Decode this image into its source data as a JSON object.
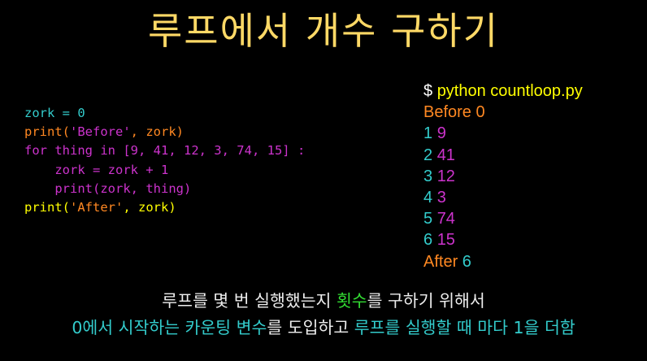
{
  "title": {
    "text": "루프에서 개수 구하기",
    "color": "#FFD966"
  },
  "colors": {
    "cyan": "#33CCCC",
    "pink": "#CC33CC",
    "orange": "#FF8822",
    "white": "#FFFFFF",
    "yellow": "#FFFF00",
    "green": "#33DD33",
    "light": "#EEEEEE"
  },
  "code_lines": [
    [
      {
        "t": "zork = 0",
        "c": "cyan"
      }
    ],
    [
      {
        "t": "print(",
        "c": "orange"
      },
      {
        "t": "'Before'",
        "c": "pink"
      },
      {
        "t": ", zork)",
        "c": "orange"
      }
    ],
    [
      {
        "t": "for ",
        "c": "pink"
      },
      {
        "t": "thing ",
        "c": "pink"
      },
      {
        "t": "in ",
        "c": "pink"
      },
      {
        "t": "[9, 41, 12, 3, 74, 15] :",
        "c": "pink"
      }
    ],
    [
      {
        "t": "    zork = zork + 1",
        "c": "pink"
      }
    ],
    [
      {
        "t": "    print(",
        "c": "pink"
      },
      {
        "t": "zork, thing",
        "c": "pink"
      },
      {
        "t": ")",
        "c": "pink"
      }
    ],
    [
      {
        "t": "print(",
        "c": "yellow"
      },
      {
        "t": "'After'",
        "c": "orange"
      },
      {
        "t": ", zork)",
        "c": "yellow"
      }
    ]
  ],
  "output_lines": [
    [
      {
        "t": "$ ",
        "c": "white"
      },
      {
        "t": "python countloop.py",
        "c": "yellow"
      }
    ],
    [
      {
        "t": "Before 0",
        "c": "orange"
      }
    ],
    [
      {
        "t": "1 ",
        "c": "cyan"
      },
      {
        "t": "9",
        "c": "pink"
      }
    ],
    [
      {
        "t": "2 ",
        "c": "cyan"
      },
      {
        "t": "41",
        "c": "pink"
      }
    ],
    [
      {
        "t": "3 ",
        "c": "cyan"
      },
      {
        "t": "12",
        "c": "pink"
      }
    ],
    [
      {
        "t": "4 ",
        "c": "cyan"
      },
      {
        "t": "3",
        "c": "pink"
      }
    ],
    [
      {
        "t": "5 ",
        "c": "cyan"
      },
      {
        "t": "74",
        "c": "pink"
      }
    ],
    [
      {
        "t": "6 ",
        "c": "cyan"
      },
      {
        "t": "15",
        "c": "pink"
      }
    ],
    [
      {
        "t": "After ",
        "c": "orange"
      },
      {
        "t": "6",
        "c": "cyan"
      }
    ]
  ],
  "caption_lines": [
    [
      {
        "t": "루프를 몇 번 실행했는지 ",
        "c": "light"
      },
      {
        "t": "횟수",
        "c": "green"
      },
      {
        "t": "를 구하기 위해서",
        "c": "light"
      }
    ],
    [
      {
        "t": "0",
        "c": "cyan"
      },
      {
        "t": "에서 시작하는 카운팅 변수",
        "c": "cyan"
      },
      {
        "t": "를 도입하고 ",
        "c": "light"
      },
      {
        "t": "루프를 실행할 때 마다 ",
        "c": "cyan"
      },
      {
        "t": "1",
        "c": "cyan"
      },
      {
        "t": "을 더함",
        "c": "cyan"
      }
    ]
  ]
}
